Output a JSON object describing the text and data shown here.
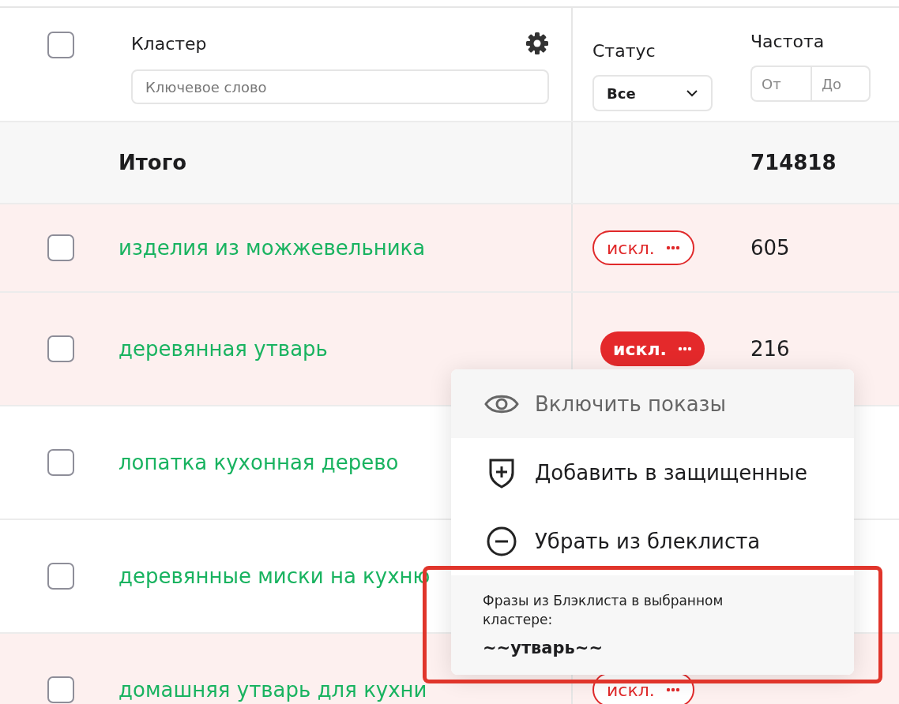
{
  "header": {
    "select_all_checked": false,
    "cluster": {
      "label": "Кластер",
      "placeholder": "Ключевое слово"
    },
    "status": {
      "label": "Статус",
      "value": "Все"
    },
    "frequency": {
      "label": "Частота",
      "from_placeholder": "От",
      "to_placeholder": "До"
    }
  },
  "total": {
    "label": "Итого",
    "frequency": "714818"
  },
  "rows": [
    {
      "checked": false,
      "excluded": true,
      "cluster": "изделия из можжевельника",
      "status": {
        "label": "искл.",
        "kind": "outline"
      },
      "frequency": "605"
    },
    {
      "checked": false,
      "excluded": true,
      "cluster": "деревянная утварь",
      "status": {
        "label": "искл.",
        "kind": "filled"
      },
      "frequency": "216"
    },
    {
      "checked": false,
      "excluded": false,
      "cluster": "лопатка кухонная дерево"
    },
    {
      "checked": false,
      "excluded": false,
      "cluster": "деревянные миски на кухню"
    },
    {
      "checked": false,
      "excluded": true,
      "cluster": "домашняя утварь для кухни",
      "status": {
        "label": "искл.",
        "kind": "outline"
      }
    }
  ],
  "menu": {
    "items": [
      {
        "label": "Включить показы",
        "kind": "show",
        "disabled": true
      },
      {
        "label": "Добавить в защищенные",
        "kind": "protect",
        "disabled": false
      },
      {
        "label": "Убрать из блеклиста",
        "kind": "unblock",
        "disabled": false
      }
    ],
    "info": {
      "text": "Фразы из Блэклиста в выбранном кластере:",
      "phrase": "~~утварь~~",
      "highlighted": true
    }
  }
}
